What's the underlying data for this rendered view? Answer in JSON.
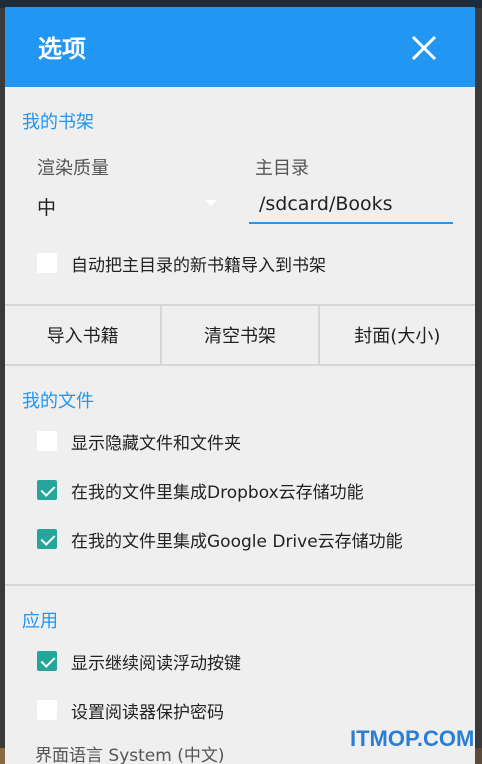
{
  "dialog": {
    "title": "选项",
    "close_icon": "close-icon"
  },
  "bookshelf": {
    "header": "我的书架",
    "render_quality_label": "渲染质量",
    "render_quality_value": "中",
    "home_dir_label": "主目录",
    "home_dir_value": "/sdcard/Books",
    "auto_import_label": "自动把主目录的新书籍导入到书架",
    "auto_import_checked": false
  },
  "buttons": {
    "import": "导入书籍",
    "clear": "清空书架",
    "cover": "封面(大小)"
  },
  "files": {
    "header": "我的文件",
    "items": [
      {
        "label": "显示隐藏文件和文件夹",
        "checked": false
      },
      {
        "label": "在我的文件里集成Dropbox云存储功能",
        "checked": true
      },
      {
        "label": "在我的文件里集成Google Drive云存储功能",
        "checked": true
      }
    ]
  },
  "app": {
    "header": "应用",
    "items": [
      {
        "label": "显示继续阅读浮动按键",
        "checked": true
      },
      {
        "label": "设置阅读器保护密码",
        "checked": false
      }
    ],
    "partial_row": "界面语言    System (中文)"
  },
  "watermark": "ITMOP.COM",
  "colors": {
    "accent": "#2196f3",
    "check": "#26a69a",
    "background": "#efefef"
  }
}
